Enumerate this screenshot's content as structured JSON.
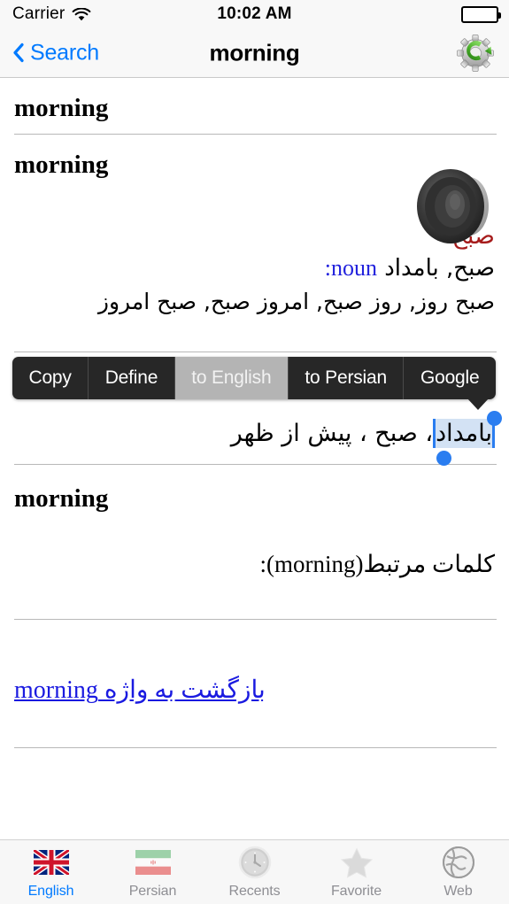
{
  "status_bar": {
    "carrier": "Carrier",
    "wifi_icon": "wifi-icon",
    "time": "10:02 AM",
    "battery_icon": "battery-full-icon"
  },
  "nav_bar": {
    "back_icon": "chevron-left-icon",
    "back_label": "Search",
    "title": "morning",
    "settings_icon": "gear-refresh-icon"
  },
  "entry": {
    "headword_1": "morning",
    "headword_2": "morning",
    "speaker_icon": "speaker-icon",
    "persian_headword": "صبح",
    "pos_label": "noun:",
    "persian_gloss": "صبح, بامداد",
    "persian_synonyms": "صبح روز, روز صبح, امروز صبح, صبح امروز",
    "selected_line_prefix": "، صبح ، پیش از ظهر",
    "selected_word": "بامداد",
    "headword_3": "morning",
    "related_words_label": "کلمات مرتبط(morning):",
    "back_link": "بازگشت به واژه morning"
  },
  "context_menu": {
    "items": [
      {
        "label": "Copy",
        "active": false
      },
      {
        "label": "Define",
        "active": false
      },
      {
        "label": "to English",
        "active": true
      },
      {
        "label": "to Persian",
        "active": false
      },
      {
        "label": "Google",
        "active": false
      }
    ]
  },
  "tab_bar": {
    "tabs": [
      {
        "label": "English",
        "icon": "uk-flag-icon",
        "active": true
      },
      {
        "label": "Persian",
        "icon": "iran-flag-icon",
        "active": false
      },
      {
        "label": "Recents",
        "icon": "clock-icon",
        "active": false
      },
      {
        "label": "Favorite",
        "icon": "star-icon",
        "active": false
      },
      {
        "label": "Web",
        "icon": "globe-icon",
        "active": false
      }
    ]
  },
  "colors": {
    "accent_blue": "#007aff",
    "persian_red": "#a61b1b",
    "pos_blue": "#2222dd",
    "link_blue": "#1a1ae0",
    "selection_blue": "#2a7df0",
    "selection_highlight": "#d3e2f4",
    "menu_dark": "#272727",
    "menu_active": "#b4b4b4"
  }
}
